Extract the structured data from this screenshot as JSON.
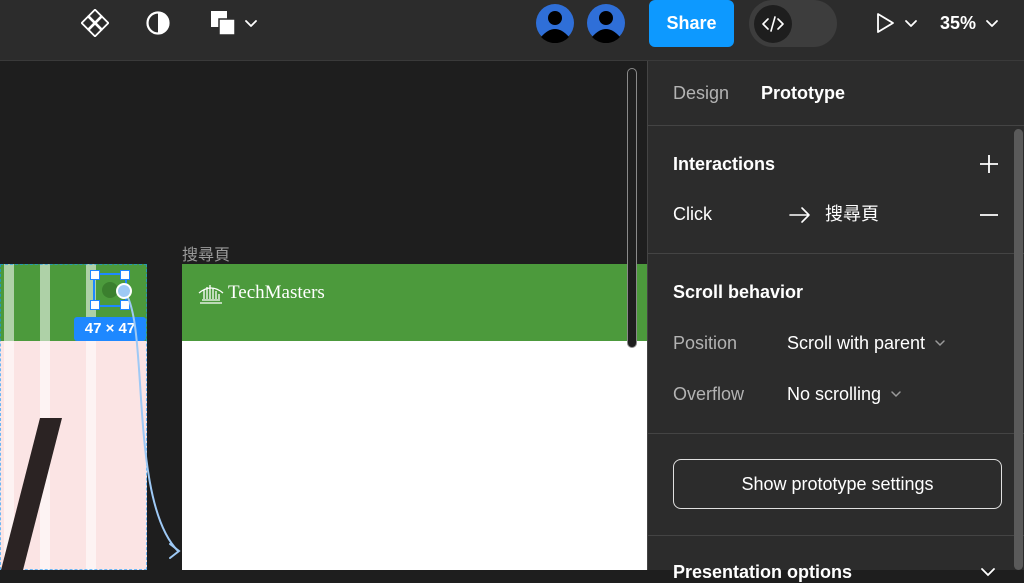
{
  "toolbar": {
    "share_label": "Share",
    "zoom_label": "35%",
    "icons": [
      "component-icon",
      "contrast-icon",
      "shape-icon",
      "avatar-icon",
      "avatar-icon",
      "code-icon",
      "play-icon",
      "chevron-down-icon"
    ]
  },
  "canvas": {
    "frame_label": "搜尋頁",
    "dimension_badge": "47 × 47",
    "logo_text": "TechMasters",
    "colors": {
      "header_green": "#4c9a3c",
      "selection_blue": "#1e88ff",
      "canvas_bg": "#1e1e1e"
    }
  },
  "panel": {
    "tabs": [
      {
        "label": "Design"
      },
      {
        "label": "Prototype"
      }
    ],
    "interactions": {
      "title": "Interactions",
      "trigger": "Click",
      "destination": "搜尋頁"
    },
    "scroll_behavior": {
      "title": "Scroll behavior",
      "position_label": "Position",
      "position_value": "Scroll with parent",
      "overflow_label": "Overflow",
      "overflow_value": "No scrolling"
    },
    "settings_button": "Show prototype settings",
    "next_section": "Presentation options"
  }
}
